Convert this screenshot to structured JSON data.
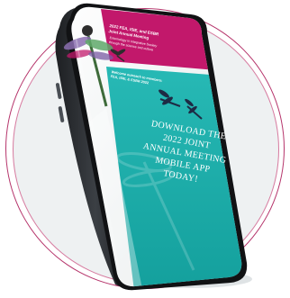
{
  "header_block": {
    "title_lines": [
      "2022 FEA, ISIE, and ESBR",
      "Joint Annual Meeting"
    ],
    "subtitle_lines": [
      "Entomology in Integrative Society",
      "through the science and culture"
    ]
  },
  "mid_block": {
    "lines": [
      "Welcome outreach to members:",
      "FEA, ISIE, & ESBR 2022"
    ]
  },
  "cta": {
    "lines": [
      "DOWNLOAD THE",
      "2022 JOINT",
      "ANNUAL MEETING",
      "MOBILE APP",
      "TODAY!"
    ]
  },
  "colors": {
    "magenta": "#c2186b",
    "teal": "#1fb3b0",
    "phone_body": "#2c2f33",
    "ring": "#b5336a"
  },
  "icons": [
    "dragonfly-icon",
    "dragonfly-icon",
    "dragonfly-icon"
  ]
}
